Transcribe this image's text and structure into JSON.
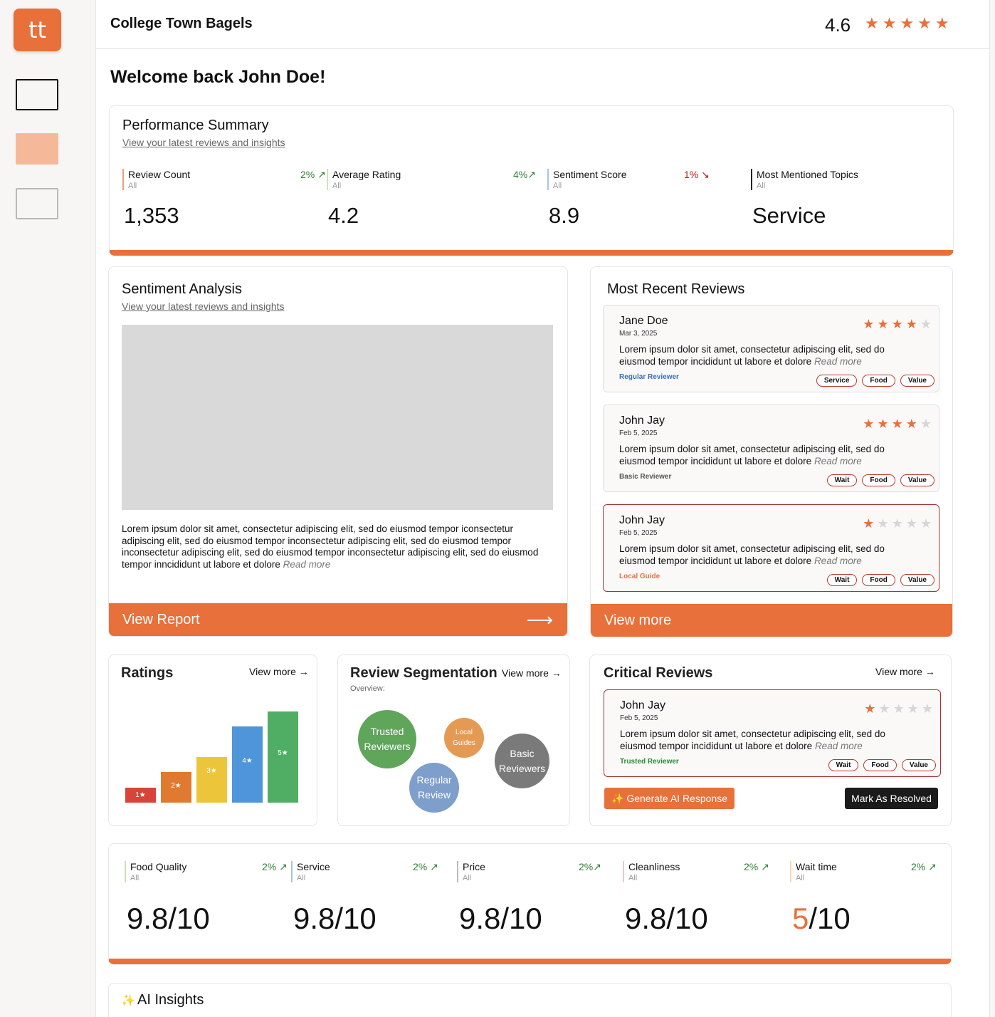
{
  "app": {
    "logo": "tt",
    "business_name": "College Town Bagels",
    "rating": "4.6",
    "stars": "★★★★★",
    "accent": "#e8703a"
  },
  "sidebar": {
    "items": [
      "dashboard-nav",
      "reviews-nav",
      "settings-nav"
    ]
  },
  "welcome": "Welcome back John Doe!",
  "performance": {
    "title": "Performance Summary",
    "subtitle": "View your latest reviews and insights",
    "metrics": [
      {
        "label": "Review Count",
        "filter": "All",
        "delta": "2% ↗",
        "value": "1,353",
        "trend": "up",
        "color": "#f0a07a"
      },
      {
        "label": "Average Rating",
        "filter": "All",
        "delta": "4%↗",
        "value": "4.2",
        "trend": "up",
        "color": "#cfe3b8"
      },
      {
        "label": "Sentiment Score",
        "filter": "All",
        "delta": "1% ↘",
        "value": "8.9",
        "trend": "down",
        "color": "#a9c4ec"
      },
      {
        "label": "Most Mentioned Topics",
        "filter": "All",
        "delta": "",
        "value": "Service",
        "trend": "none",
        "color": "#222222"
      }
    ]
  },
  "sentiment": {
    "title": "Sentiment Analysis",
    "subtitle": "View your latest reviews and insights",
    "text": "Lorem ipsum dolor sit amet, consectetur adipiscing elit, sed do eiusmod tempor iconsectetur adipiscing elit, sed do eiusmod tempor inconsectetur adipiscing elit, sed do eiusmod tempor inconsectetur adipiscing elit, sed do eiusmod tempor inconsectetur adipiscing elit, sed do eiusmod tempor inncididunt ut labore et dolore",
    "read_more": "Read more",
    "footer": "View Report",
    "footer_arrow": "⟶"
  },
  "recent": {
    "title": "Most Recent Reviews",
    "footer": "View more",
    "reviews": [
      {
        "name": "Jane Doe",
        "date": "Mar 3, 2025",
        "rating": 4,
        "text": "Lorem ipsum dolor sit amet, consectetur adipiscing elit, sed do eiusmod tempor incididunt ut labore et dolore",
        "read_more": "Read more",
        "tag": "Regular Reviewer",
        "tag_color": "#3a6fb5",
        "chips": [
          "Service",
          "Food",
          "Value"
        ],
        "critical": false
      },
      {
        "name": "John Jay",
        "date": "Feb 5, 2025",
        "rating": 4,
        "text": "Lorem ipsum dolor sit amet, consectetur adipiscing elit, sed do eiusmod tempor incididunt ut labore et dolore",
        "read_more": "Read more",
        "tag": "Basic Reviewer",
        "tag_color": "#555555",
        "chips": [
          "Wait",
          "Food",
          "Value"
        ],
        "critical": false
      },
      {
        "name": "John Jay",
        "date": "Feb 5, 2025",
        "rating": 1,
        "text": "Lorem ipsum dolor sit amet, consectetur adipiscing elit, sed do eiusmod tempor incididunt ut labore et dolore",
        "read_more": "Read more",
        "tag": "Local Guide",
        "tag_color": "#e8703a",
        "chips": [
          "Wait",
          "Food",
          "Value"
        ],
        "critical": true
      }
    ]
  },
  "ratings": {
    "title": "Ratings",
    "view_more": "View more →",
    "bars": [
      {
        "label": "1★",
        "value": 1,
        "color": "#d9443a"
      },
      {
        "label": "2★",
        "value": 2,
        "color": "#e07a30"
      },
      {
        "label": "3★",
        "value": 3,
        "color": "#ecc53a"
      },
      {
        "label": "4★",
        "value": 5,
        "color": "#4f95d9"
      },
      {
        "label": "5★",
        "value": 6,
        "color": "#4fae63"
      }
    ]
  },
  "segmentation": {
    "title": "Review Segmentation",
    "view_more": "View more →",
    "overview": "Overview:",
    "bubbles": [
      {
        "label": "Trusted Reviewers",
        "color": "#5fa55a"
      },
      {
        "label": "Local Guides",
        "color": "#e49a53"
      },
      {
        "label": "Basic Reviewers",
        "color": "#7a7a7a"
      },
      {
        "label": "Regular Review",
        "color": "#7e9ecb"
      }
    ]
  },
  "critical": {
    "title": "Critical Reviews",
    "view_more": "View more →",
    "review": {
      "name": "John Jay",
      "date": "Feb 5, 2025",
      "rating": 1,
      "text": "Lorem ipsum dolor sit amet, consectetur adipiscing elit, sed do eiusmod tempor incididunt ut labore et dolore",
      "read_more": "Read more",
      "tag": "Trusted Reviewer",
      "tag_color": "#2e8b3a",
      "chips": [
        "Wait",
        "Food",
        "Value"
      ]
    },
    "generate_label": "✨ Generate AI Response",
    "resolve_label": "Mark As Resolved"
  },
  "scores": [
    {
      "label": "Food Quality",
      "filter": "All",
      "delta": "2% ↗",
      "score": "9.8",
      "total": "/10",
      "color": "#cfe3b8",
      "highlight": false
    },
    {
      "label": "Service",
      "filter": "All",
      "delta": "2% ↗",
      "score": "9.8",
      "total": "/10",
      "color": "#a9c4ec",
      "highlight": false
    },
    {
      "label": "Price",
      "filter": "All",
      "delta": "2%↗",
      "score": "9.8",
      "total": "/10",
      "color": "#bbbbbb",
      "highlight": false
    },
    {
      "label": "Cleanliness",
      "filter": "All",
      "delta": "2% ↗",
      "score": "9.8",
      "total": "/10",
      "color": "#f4c6c6",
      "highlight": false
    },
    {
      "label": "Wait time",
      "filter": "All",
      "delta": "2% ↗",
      "score": "5",
      "total": "/10",
      "color": "#f7d9b0",
      "highlight": true
    }
  ],
  "ai_insights": {
    "title": "AI Insights",
    "icon": "✨"
  }
}
